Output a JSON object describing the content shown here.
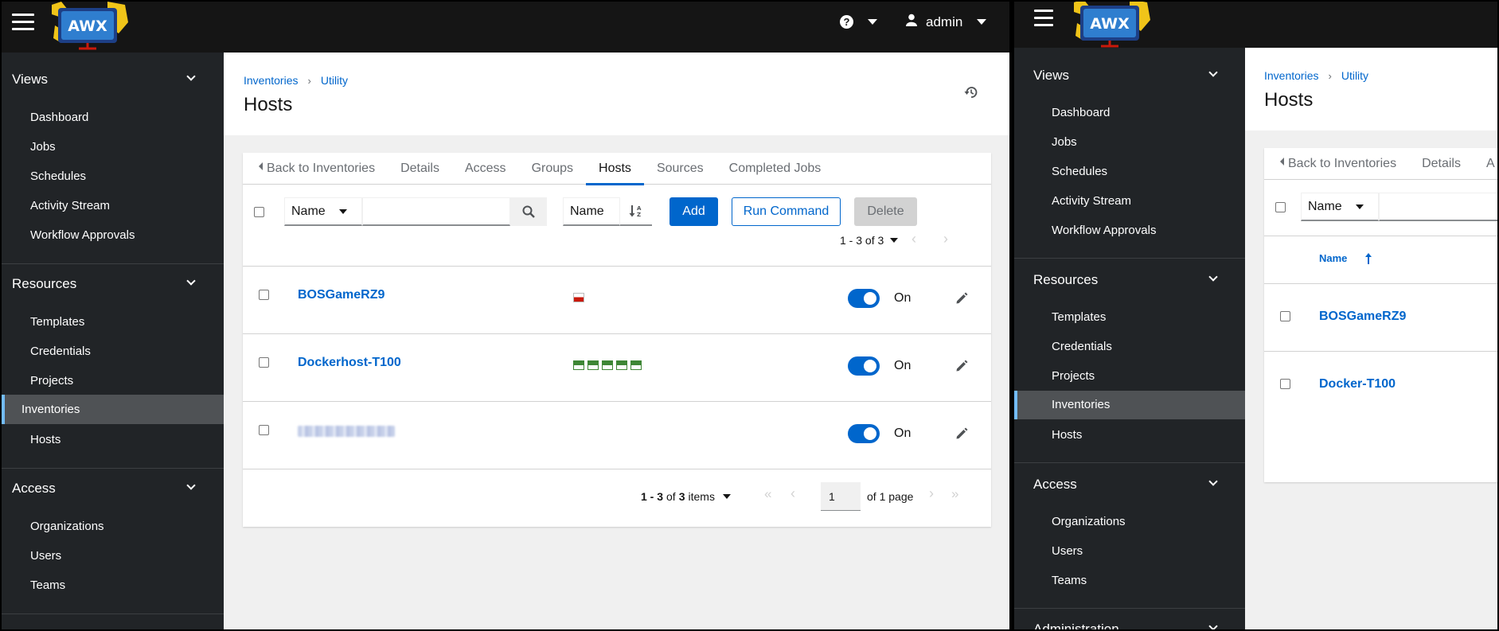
{
  "app": {
    "logo_text": "AWX",
    "help_icon": "question-circle-icon",
    "user_icon": "user-icon",
    "username": "admin"
  },
  "sidebar": {
    "groups": [
      {
        "label": "Views",
        "items": [
          "Dashboard",
          "Jobs",
          "Schedules",
          "Activity Stream",
          "Workflow Approvals"
        ]
      },
      {
        "label": "Resources",
        "items": [
          "Templates",
          "Credentials",
          "Projects",
          "Inventories",
          "Hosts"
        ]
      },
      {
        "label": "Access",
        "items": [
          "Organizations",
          "Users",
          "Teams"
        ]
      },
      {
        "label": "Administration",
        "items": []
      }
    ],
    "active_item": "Inventories"
  },
  "breadcrumb": {
    "parent": "Inventories",
    "current": "Utility"
  },
  "page": {
    "title": "Hosts",
    "history_icon": "history-icon"
  },
  "tabs": [
    {
      "label": "Back to Inventories",
      "icon": "caret-left-icon"
    },
    {
      "label": "Details"
    },
    {
      "label": "Access"
    },
    {
      "label": "Groups"
    },
    {
      "label": "Hosts",
      "active": true
    },
    {
      "label": "Sources"
    },
    {
      "label": "Completed Jobs"
    }
  ],
  "right_tabs_partial": "A",
  "toolbar": {
    "search_filter": "Name",
    "search_value": "",
    "sort_by": "Name",
    "add_label": "Add",
    "run_command_label": "Run Command",
    "delete_label": "Delete",
    "pagination_top": "1 - 3 of 3"
  },
  "hosts_left": [
    {
      "name": "BOSGameRZ9",
      "recent_jobs": [
        "failed"
      ],
      "enabled": true,
      "toggle_label": "On"
    },
    {
      "name": "Dockerhost-T100",
      "recent_jobs": [
        "successful",
        "successful",
        "successful",
        "successful",
        "successful"
      ],
      "enabled": true,
      "toggle_label": "On"
    },
    {
      "name": "",
      "obscured": true,
      "recent_jobs": [],
      "enabled": true,
      "toggle_label": "On"
    }
  ],
  "hosts_right": [
    {
      "name": "BOSGameRZ9"
    },
    {
      "name": "Docker-T100"
    }
  ],
  "list_header": {
    "sort_column": "Name",
    "sort_icon": "arrow-up-icon"
  },
  "pagination_bottom": {
    "range": "1 - 3",
    "of_label": "of",
    "total": "3",
    "unit": "items",
    "page": "1",
    "of_pages": "of 1 page"
  },
  "colors": {
    "masthead": "#151515",
    "sidebar": "#212427",
    "sidebar_active": "#4f5255",
    "sidebar_active_accent": "#73bcf7",
    "link": "#06c",
    "primary": "#06c",
    "job_failed": "#c9190b",
    "job_success": "#3e8635"
  }
}
